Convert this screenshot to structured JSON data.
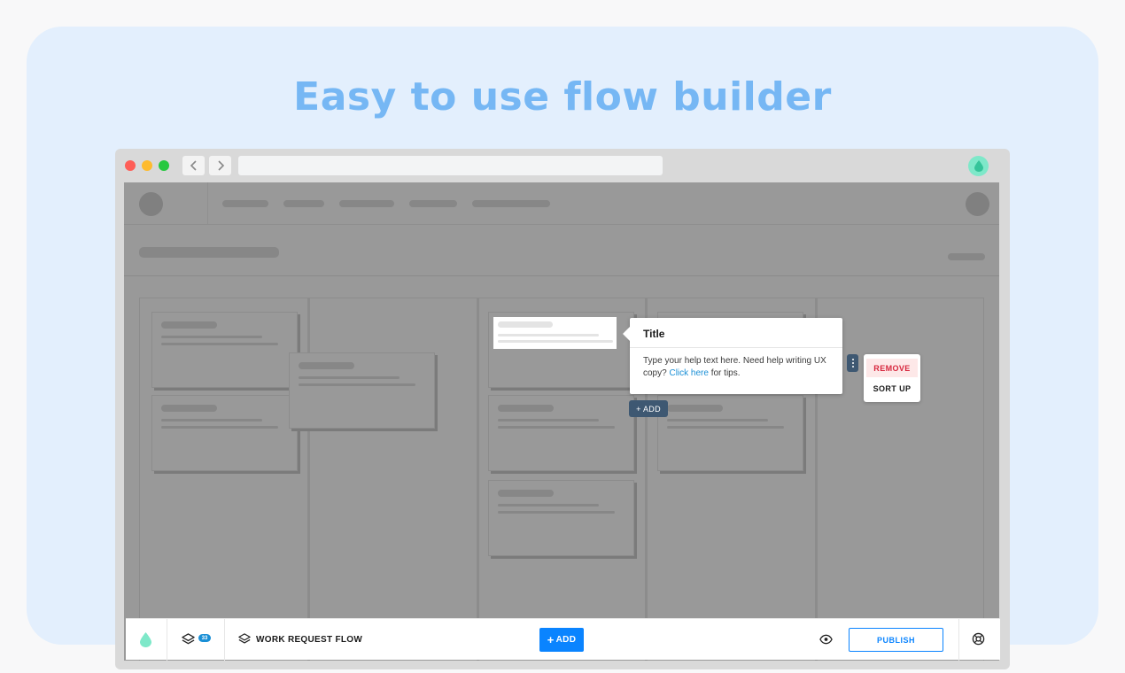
{
  "headline": "Easy to use flow builder",
  "tooltip": {
    "title": "Title",
    "body_prefix": "Type your help text here. Need help writing UX copy?",
    "link_text": "Click here",
    "body_suffix": "for tips."
  },
  "add_chip": "+ ADD",
  "context_menu": {
    "remove": "REMOVE",
    "sort_up": "SORT UP"
  },
  "bottom_bar": {
    "layers_count": "33",
    "flow_title": "WORK REQUEST FLOW",
    "add_button": "ADD",
    "publish_button": "PUBLISH"
  },
  "colors": {
    "accent": "#0a84ff",
    "headline": "#76b7f4",
    "danger": "#d7263d",
    "chip": "#3e5872"
  },
  "icons": [
    "chevron-left-icon",
    "chevron-right-icon",
    "drop-icon",
    "layers-icon",
    "eye-icon",
    "lifebuoy-icon",
    "kebab-icon"
  ]
}
